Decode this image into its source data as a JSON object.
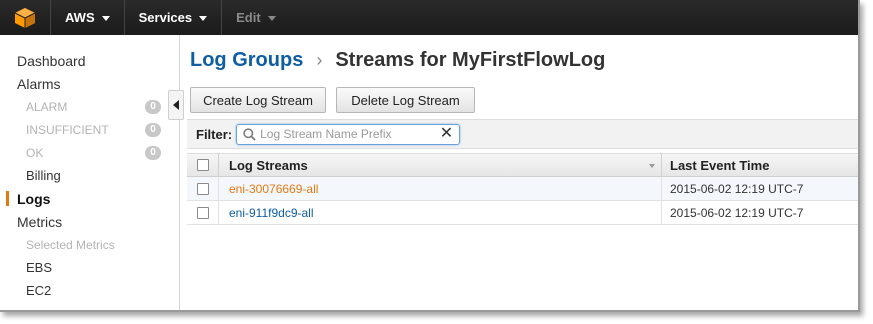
{
  "topnav": {
    "logo_icon": "aws-cube-icon",
    "aws_label": "AWS",
    "services_label": "Services",
    "edit_label": "Edit"
  },
  "sidebar": {
    "items": [
      {
        "label": "Dashboard"
      },
      {
        "label": "Alarms"
      },
      {
        "label": "ALARM",
        "count": "0"
      },
      {
        "label": "INSUFFICIENT",
        "count": "0"
      },
      {
        "label": "OK",
        "count": "0"
      },
      {
        "label": "Billing"
      },
      {
        "label": "Logs"
      },
      {
        "label": "Metrics"
      },
      {
        "label": "Selected Metrics"
      },
      {
        "label": "EBS"
      },
      {
        "label": "EC2"
      }
    ]
  },
  "breadcrumb": {
    "parent": "Log Groups",
    "separator": "›",
    "current": "Streams for MyFirstFlowLog"
  },
  "toolbar": {
    "create_label": "Create Log Stream",
    "delete_label": "Delete Log Stream"
  },
  "filter": {
    "label": "Filter:",
    "placeholder": "Log Stream Name Prefix",
    "value": "",
    "clear_icon": "close-icon"
  },
  "table": {
    "columns": [
      "Log Streams",
      "Last Event Time"
    ],
    "rows": [
      {
        "name": "eni-30076669-all",
        "time": "2015-06-02 12:19 UTC-7"
      },
      {
        "name": "eni-911f9dc9-all",
        "time": "2015-06-02 12:19 UTC-7"
      }
    ]
  },
  "colors": {
    "link": "#0e5ea4",
    "accent_orange": "#e47911",
    "topbar": "#1f1f1f"
  }
}
